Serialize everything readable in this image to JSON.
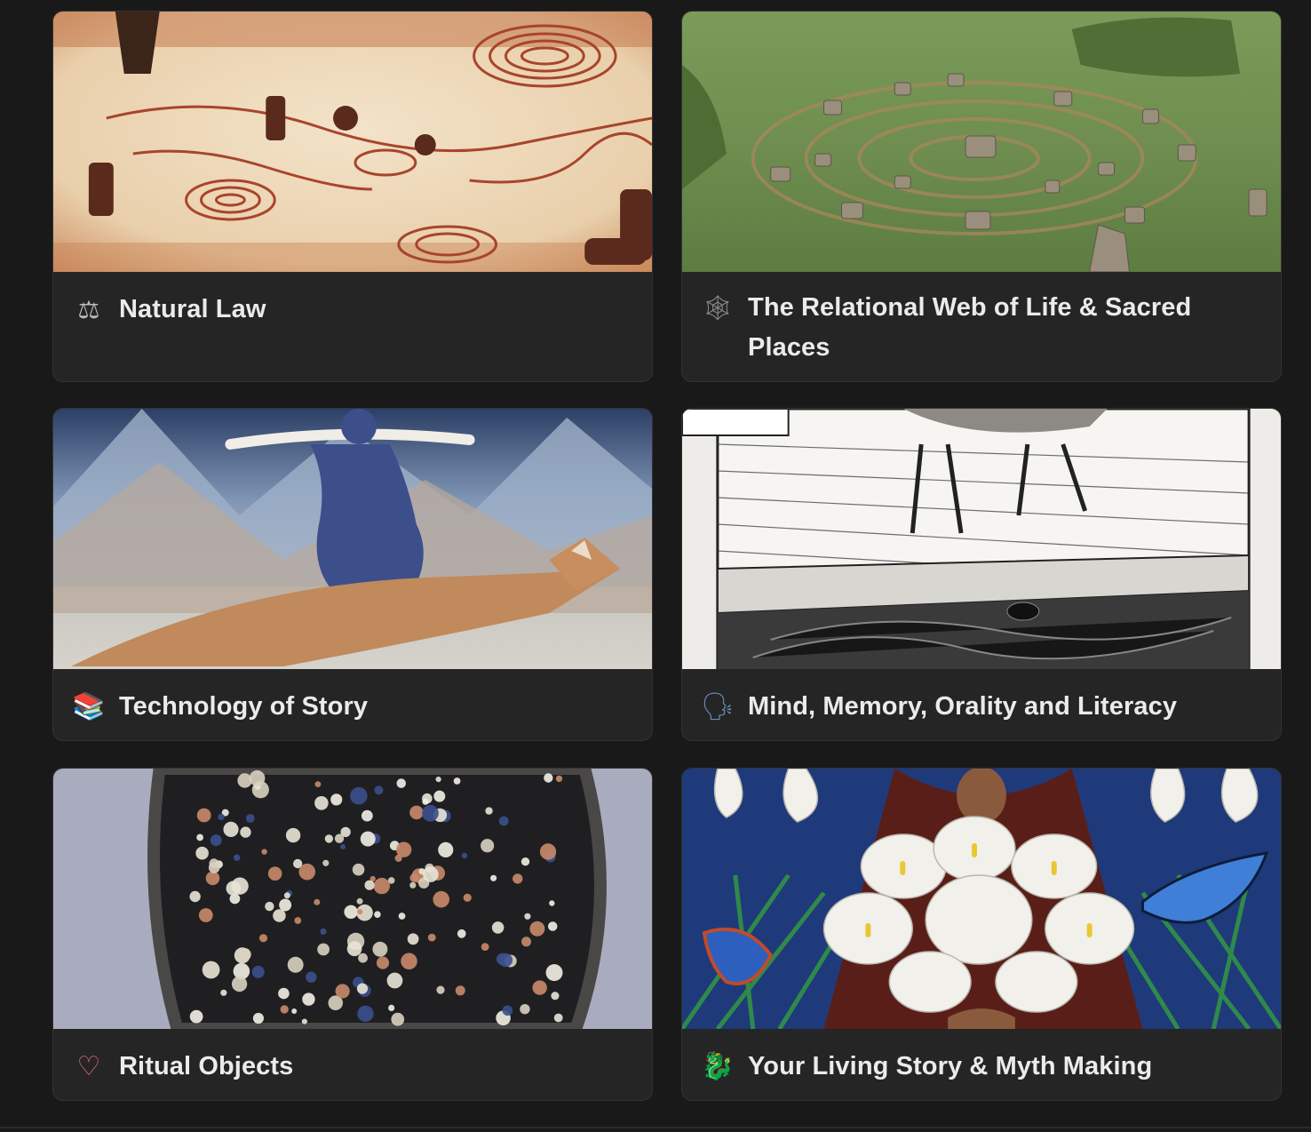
{
  "gallery": {
    "cards": [
      {
        "icon": "balance-scale-icon",
        "emoji": "⚖",
        "title": "Natural Law"
      },
      {
        "icon": "spider-web-icon",
        "emoji": "🕸",
        "title": "The Relational Web of Life & Sacred Places"
      },
      {
        "icon": "books-icon",
        "emoji": "📚",
        "title": "Technology of Story"
      },
      {
        "icon": "speaking-head-icon",
        "emoji": "🗣",
        "title": "Mind, Memory, Orality and Literacy"
      },
      {
        "icon": "heart-outline-icon",
        "emoji": "♡",
        "title": "Ritual Objects"
      },
      {
        "icon": "dragon-icon",
        "emoji": "🐉",
        "title": "Your Living Story & Myth Making"
      }
    ]
  },
  "colors": {
    "page_background": "#191919",
    "card_background": "#252525",
    "card_border": "#333333",
    "title_text": "#ebebeb"
  }
}
